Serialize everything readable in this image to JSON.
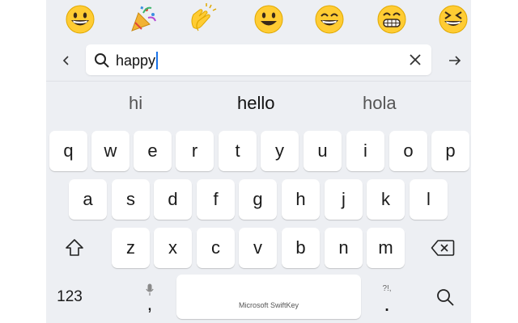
{
  "emoji_row": [
    {
      "name": "grinning-face"
    },
    {
      "name": "party-popper"
    },
    {
      "name": "clapping-hands"
    },
    {
      "name": "smiley-face"
    },
    {
      "name": "grinning-smiling-eyes"
    },
    {
      "name": "beaming-face"
    },
    {
      "name": "squinting-face"
    }
  ],
  "search": {
    "query": "happy",
    "back_icon": "chevron-left-icon",
    "search_icon": "search-icon",
    "clear_icon": "close-icon",
    "go_icon": "arrow-right-icon"
  },
  "suggestions": [
    "hi",
    "hello",
    "hola"
  ],
  "keyboard": {
    "row1": [
      "q",
      "w",
      "e",
      "r",
      "t",
      "y",
      "u",
      "i",
      "o",
      "p"
    ],
    "row2": [
      "a",
      "s",
      "d",
      "f",
      "g",
      "h",
      "j",
      "k",
      "l"
    ],
    "row3": [
      "z",
      "x",
      "c",
      "v",
      "b",
      "n",
      "m"
    ],
    "numbers_label": "123",
    "comma": ",",
    "period": ".",
    "punct_hint": "?!,",
    "space_label": "Microsoft SwiftKey"
  },
  "colors": {
    "panel_bg": "#edeff3",
    "key_bg": "#ffffff",
    "caret": "#1a73e8",
    "emoji_yellow": "#ffcc33"
  }
}
